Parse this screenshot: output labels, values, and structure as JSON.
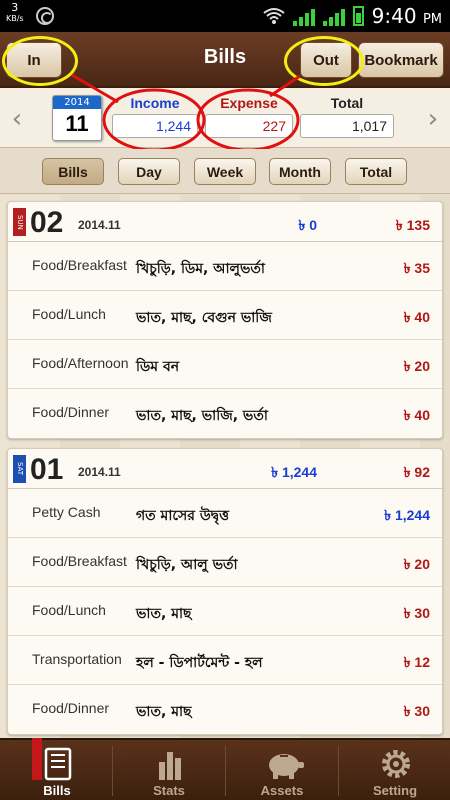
{
  "status": {
    "kbs_value": "3",
    "kbs_unit": "KB/s",
    "time": "9:40",
    "ampm": "PM"
  },
  "header": {
    "title": "Bills",
    "in_label": "In",
    "out_label": "Out",
    "bookmark_label": "Bookmark"
  },
  "summary": {
    "year": "2014",
    "day": "11",
    "income_label": "Income",
    "income_value": "1,244",
    "expense_label": "Expense",
    "expense_value": "227",
    "total_label": "Total",
    "total_value": "1,017",
    "prev_arrow": "‹",
    "next_arrow": "›"
  },
  "tabs": [
    "Bills",
    "Day",
    "Week",
    "Month",
    "Total"
  ],
  "days": [
    {
      "dow": "SUN",
      "day": "02",
      "ym": "2014.11",
      "income": "৳ 0",
      "expense": "৳ 135",
      "rows": [
        {
          "category": "Food/Breakfast",
          "memo": "খিচুড়ি, ডিম, আলুভর্তা",
          "amount": "৳ 35",
          "type": "expense"
        },
        {
          "category": "Food/Lunch",
          "memo": "ভাত, মাছ, বেগুন ভাজি",
          "amount": "৳ 40",
          "type": "expense"
        },
        {
          "category": "Food/Afternoon",
          "memo": "ডিম বন",
          "amount": "৳ 20",
          "type": "expense"
        },
        {
          "category": "Food/Dinner",
          "memo": "ভাত, মাছ, ভাজি, ভর্তা",
          "amount": "৳ 40",
          "type": "expense"
        }
      ]
    },
    {
      "dow": "SAT",
      "day": "01",
      "ym": "2014.11",
      "income": "৳ 1,244",
      "expense": "৳ 92",
      "rows": [
        {
          "category": "Petty Cash",
          "memo": "গত মাসের উদ্বৃত্ত",
          "amount": "৳ 1,244",
          "type": "income"
        },
        {
          "category": "Food/Breakfast",
          "memo": "খিচুড়ি, আলু ভর্তা",
          "amount": "৳ 20",
          "type": "expense"
        },
        {
          "category": "Food/Lunch",
          "memo": "ভাত, মাছ",
          "amount": "৳ 30",
          "type": "expense"
        },
        {
          "category": "Transportation",
          "memo": "হল - ডিপার্টমেন্ট - হল",
          "amount": "৳ 12",
          "type": "expense"
        },
        {
          "category": "Food/Dinner",
          "memo": "ভাত, মাছ",
          "amount": "৳ 30",
          "type": "expense"
        }
      ]
    }
  ],
  "nav": [
    {
      "label": "Bills",
      "icon": "notebook-icon"
    },
    {
      "label": "Stats",
      "icon": "bar-chart-icon"
    },
    {
      "label": "Assets",
      "icon": "piggy-bank-icon"
    },
    {
      "label": "Setting",
      "icon": "gear-icon"
    }
  ],
  "colors": {
    "income": "#1a3ed0",
    "expense": "#b01818",
    "header": "#4a2714",
    "highlight_ring": "#f4ef12",
    "annotation_ring": "#e01010"
  }
}
